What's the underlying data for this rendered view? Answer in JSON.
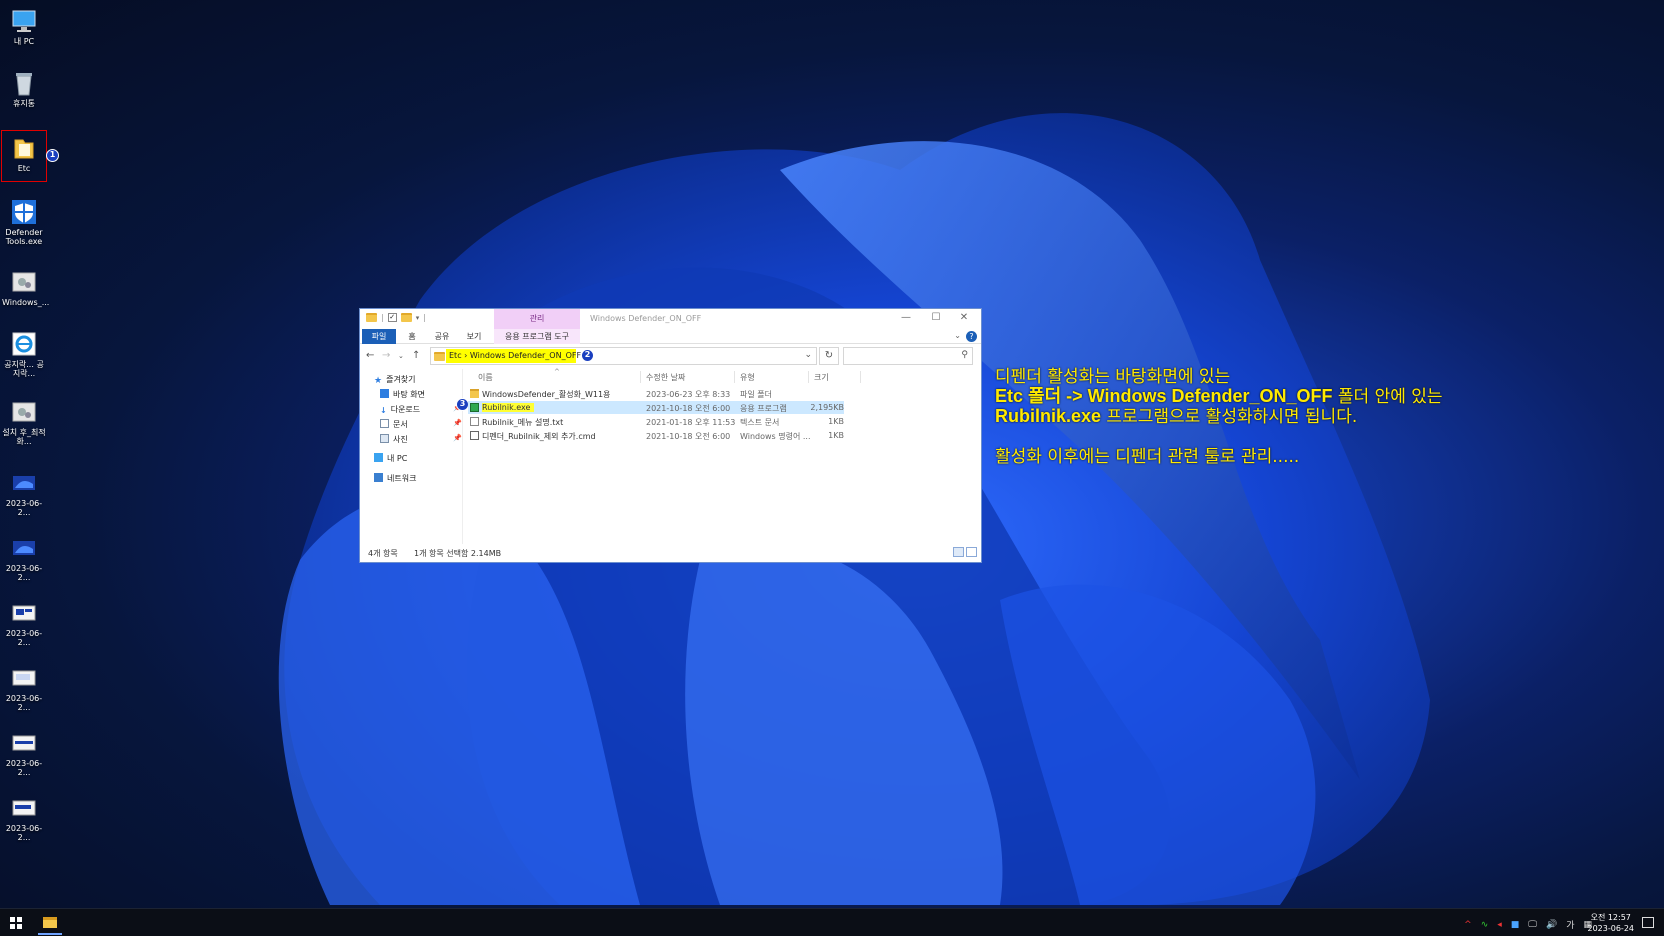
{
  "desktop": {
    "icons": [
      {
        "label": "내 PC"
      },
      {
        "label": "휴지통"
      },
      {
        "label": "Etc"
      },
      {
        "label": "Defender Tools.exe"
      },
      {
        "label": "Windows_..."
      },
      {
        "label": "공지락... 공지락..."
      },
      {
        "label": "설치 후_최적화..."
      },
      {
        "label": "2023-06-2..."
      },
      {
        "label": "2023-06-2..."
      },
      {
        "label": "2023-06-2..."
      },
      {
        "label": "2023-06-2..."
      },
      {
        "label": "2023-06-2..."
      },
      {
        "label": "2023-06-2..."
      }
    ],
    "badges": [
      "1",
      "2",
      "3"
    ]
  },
  "explorer": {
    "title": "Windows Defender_ON_OFF",
    "context_tab": "관리",
    "ribbon_tabs": [
      "파일",
      "홈",
      "공유",
      "보기",
      "응용 프로그램 도구"
    ],
    "address": "Etc  ›  Windows Defender_ON_OFF",
    "search_placeholder": "",
    "nav": {
      "quick_access": "즐겨찾기",
      "items": [
        "바탕 화면",
        "다운로드",
        "문서",
        "사진"
      ],
      "this_pc": "내 PC",
      "network": "네트워크"
    },
    "columns": [
      "이름",
      "수정한 날짜",
      "유형",
      "크기"
    ],
    "rows": [
      {
        "name": "WindowsDefender_활성화_W11용",
        "date": "2023-06-23 오후 8:33",
        "type": "파일 폴더",
        "size": ""
      },
      {
        "name": "Rubilnik.exe",
        "date": "2021-10-18 오전 6:00",
        "type": "응용 프로그램",
        "size": "2,195KB"
      },
      {
        "name": "Rubilnik_메뉴 설명.txt",
        "date": "2021-01-18 오후 11:53",
        "type": "텍스트 문서",
        "size": "1KB"
      },
      {
        "name": "디펜더_Rubilnik_제외 추가.cmd",
        "date": "2021-10-18 오전 6:00",
        "type": "Windows 명령어 ...",
        "size": "1KB"
      }
    ],
    "status_count": "4개 항목",
    "status_selection": "1개 항목 선택함 2.14MB"
  },
  "note": {
    "line1": "디펜더 활성화는 바탕화면에 있는",
    "line2a": "Etc 폴더 -> Windows Defender_ON_OFF",
    "line2b": " 폴더 안에 있는",
    "line3a": "Rubilnik.exe",
    "line3b": " 프로그램으로 활성화하시면 됩니다.",
    "line4": "활성화 이후에는 디펜더 관련 툴로 관리....."
  },
  "taskbar": {
    "tray": [
      "^",
      "∿",
      "◂",
      "■",
      "🖵",
      "🔊",
      "가",
      "▦"
    ],
    "time": "오전 12:57",
    "date": "2023-06-24"
  },
  "colors": {
    "note_text": "#ffea00",
    "selection_highlight": "#ffff00",
    "ribbon_file_tab": "#1b5fb7",
    "context_tab": "#f1cff7",
    "badge": "#1a3fbf"
  }
}
